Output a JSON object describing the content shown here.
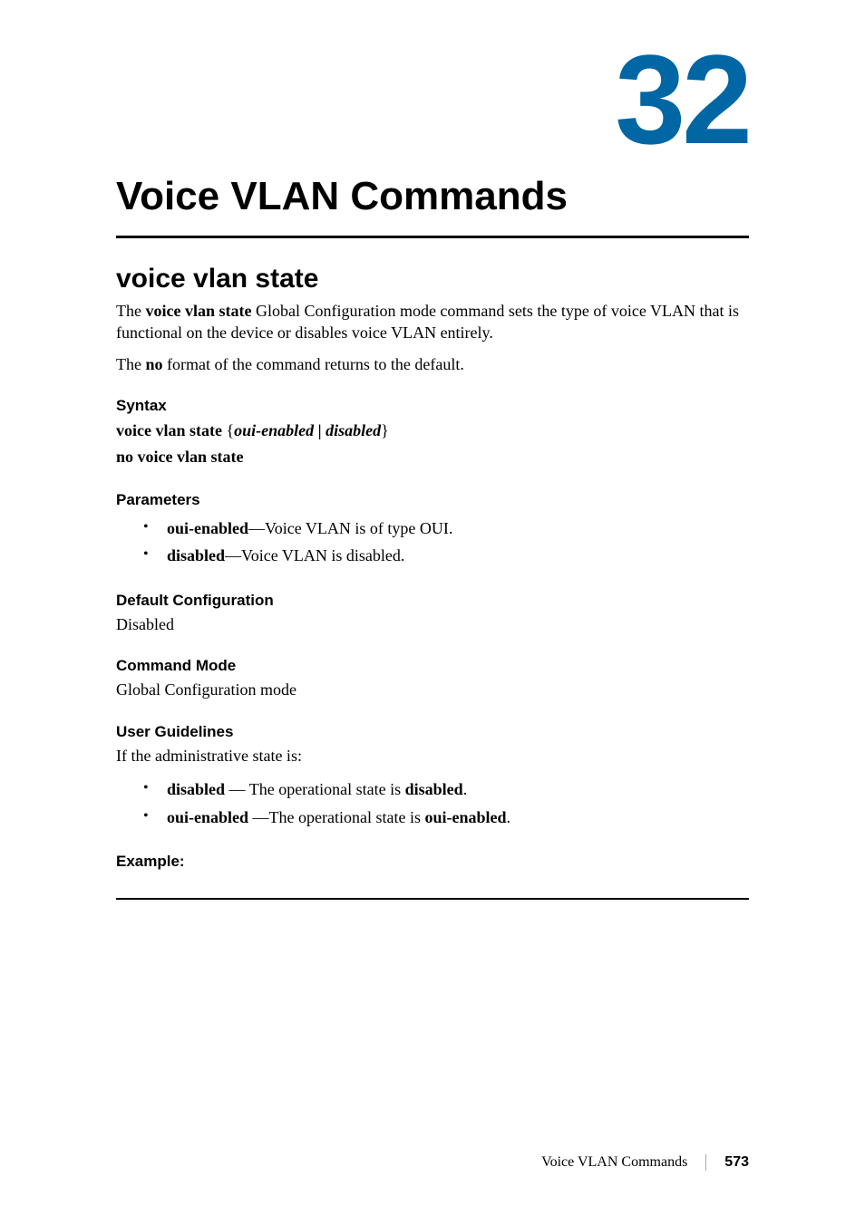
{
  "chapter": {
    "number": "32",
    "title": "Voice VLAN Commands"
  },
  "section": {
    "title": "voice vlan state",
    "intro1_pre": "The ",
    "intro1_cmd": "voice vlan state",
    "intro1_post": " Global Configuration mode command sets the type of voice VLAN that is functional on the device or disables voice VLAN entirely.",
    "intro2_pre": "The ",
    "intro2_cmd": "no",
    "intro2_post": " format of the command returns to the default."
  },
  "syntax": {
    "heading": "Syntax",
    "line1_a": "voice vlan state ",
    "line1_b": "{",
    "line1_c": "oui-enabled",
    "line1_d": " | ",
    "line1_e": " disabled",
    "line1_f": "}",
    "line2": "no voice vlan state"
  },
  "parameters": {
    "heading": "Parameters",
    "items": [
      {
        "bold": "oui-enabled",
        "rest": "—Voice VLAN is of type OUI."
      },
      {
        "bold": "disabled",
        "rest": "—Voice VLAN is disabled."
      }
    ]
  },
  "default_config": {
    "heading": "Default Configuration",
    "text": "Disabled"
  },
  "command_mode": {
    "heading": "Command Mode",
    "text": "Global Configuration mode"
  },
  "user_guidelines": {
    "heading": "User Guidelines",
    "intro": "If the administrative state is:",
    "items": [
      {
        "b1": "disabled",
        "mid": " — The operational state is ",
        "b2": "disabled",
        "end": "."
      },
      {
        "b1": "oui-enabled",
        "mid": " —The operational state is ",
        "b2": "oui-enabled",
        "end": "."
      }
    ]
  },
  "example": {
    "heading": "Example:"
  },
  "footer": {
    "title": "Voice VLAN Commands",
    "page": "573"
  }
}
